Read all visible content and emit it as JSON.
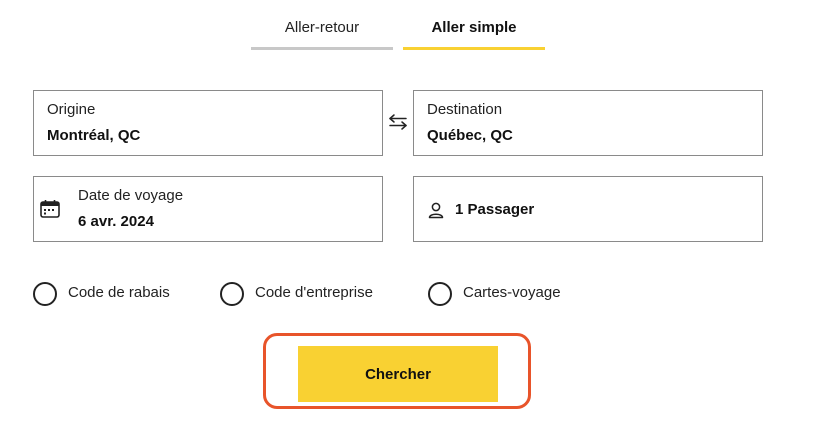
{
  "colors": {
    "accent": "#f9d132",
    "inactive_underline": "#c8c8c8",
    "highlight_border": "#e8542a",
    "border": "#8a8a8a"
  },
  "tabs": {
    "round_trip": "Aller-retour",
    "one_way": "Aller simple",
    "active": "one_way"
  },
  "origin": {
    "label": "Origine",
    "value": "Montréal, QC"
  },
  "destination": {
    "label": "Destination",
    "value": "Québec, QC"
  },
  "swap": {
    "icon": "swap-arrows-icon"
  },
  "travel_date": {
    "label": "Date de voyage",
    "value": "6 avr. 2024",
    "icon": "calendar-icon"
  },
  "passengers": {
    "value": "1 Passager",
    "icon": "person-icon"
  },
  "options": [
    {
      "label": "Code de rabais",
      "selected": false
    },
    {
      "label": "Code d'entreprise",
      "selected": false
    },
    {
      "label": "Cartes-voyage",
      "selected": false
    }
  ],
  "search": {
    "label": "Chercher"
  }
}
